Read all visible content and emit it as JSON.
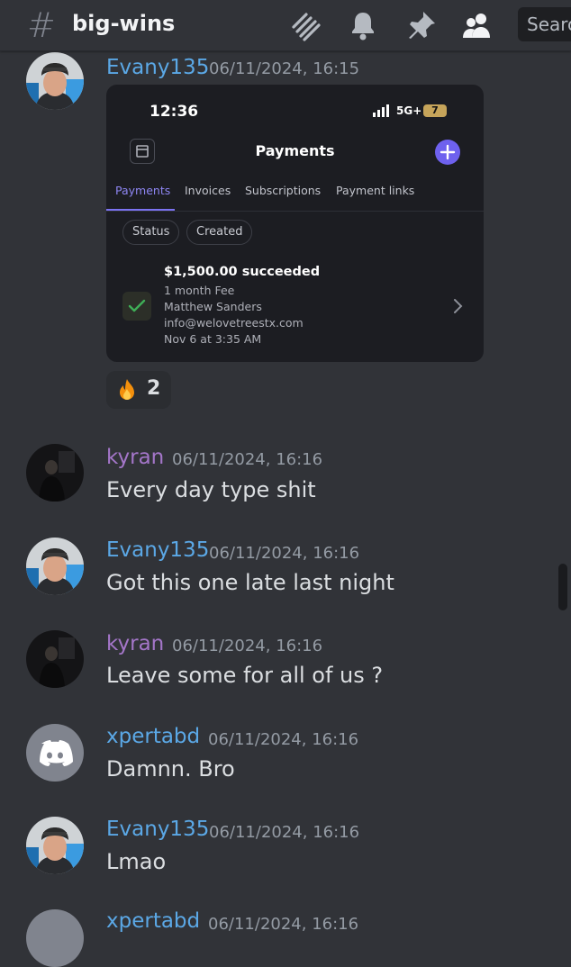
{
  "header": {
    "channel_icon": "hash-icon",
    "channel_name": "big-wins",
    "icons": [
      "threads-icon",
      "bell-icon",
      "pin-icon",
      "members-icon"
    ],
    "search_placeholder": "Search"
  },
  "messages": [
    {
      "author": "Evany135",
      "timestamp": "06/11/2024, 16:15",
      "attachment": {
        "status_time": "12:36",
        "network": "5G+",
        "battery": "7",
        "title": "Payments",
        "tabs": [
          "Payments",
          "Invoices",
          "Subscriptions",
          "Payment links"
        ],
        "active_tab": "Payments",
        "filters": [
          "Status",
          "Created"
        ],
        "payment": {
          "amount": "$1,500.00 succeeded",
          "description": "1 month Fee",
          "customer": "Matthew Sanders",
          "email": "info@welovetreestx.com",
          "date": "Nov 6 at 3:35 AM"
        }
      },
      "reaction": {
        "emoji": "fire-icon",
        "count": "2"
      }
    },
    {
      "author": "kyran",
      "timestamp": "06/11/2024, 16:16",
      "text": "Every day type shit"
    },
    {
      "author": "Evany135",
      "timestamp": "06/11/2024, 16:16",
      "text": "Got this one late last night"
    },
    {
      "author": "kyran",
      "timestamp": "06/11/2024, 16:16",
      "text": "Leave some for all of us ?"
    },
    {
      "author": "xpertabd",
      "timestamp": "06/11/2024, 16:16",
      "text": "Damnn. Bro"
    },
    {
      "author": "Evany135",
      "timestamp": "06/11/2024, 16:16",
      "text": "Lmao"
    },
    {
      "author": "xpertabd",
      "timestamp": "06/11/2024, 16:16"
    }
  ],
  "colors": {
    "background": "#313338",
    "username_blue": "#5ba8e6",
    "username_purple": "#a476c9",
    "timestamp": "#949ba4",
    "accent": "#6e61ee"
  }
}
